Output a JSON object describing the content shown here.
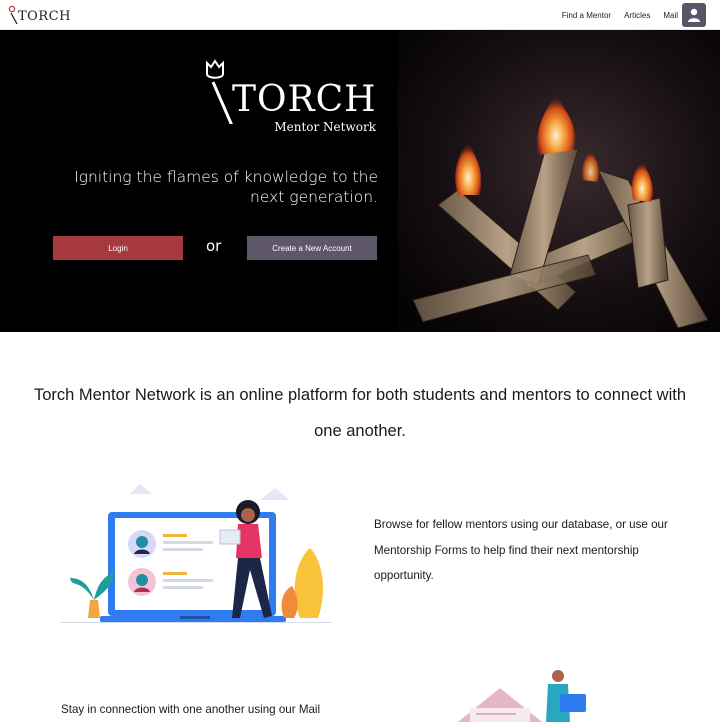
{
  "nav": {
    "logo_text": "TORCH",
    "links": [
      "Find a Mentor",
      "Articles",
      "Mail"
    ],
    "profile_icon": "user-icon"
  },
  "hero": {
    "brand_word": "TORCH",
    "brand_sub": "Mentor Network",
    "tagline": "Igniting the flames of knowledge to the next generation.",
    "login_label": "Login",
    "or_label": "or",
    "create_label": "Create a New Account",
    "image": "burning-torches-photo"
  },
  "content": {
    "intro": "Torch Mentor Network is an online platform for both students and mentors to connect with one another.",
    "browse_text": "Browse for fellow mentors using our database, or use our Mentorship Forms to help find their next mentorship opportunity.",
    "stay_text": "Stay in connection with one another using our Mail"
  },
  "colors": {
    "login": "#a6393f",
    "create": "#5e5669",
    "hero_bg": "#000000",
    "laptop": "#2f7bf0",
    "avatar_bg": "#5a5468"
  }
}
